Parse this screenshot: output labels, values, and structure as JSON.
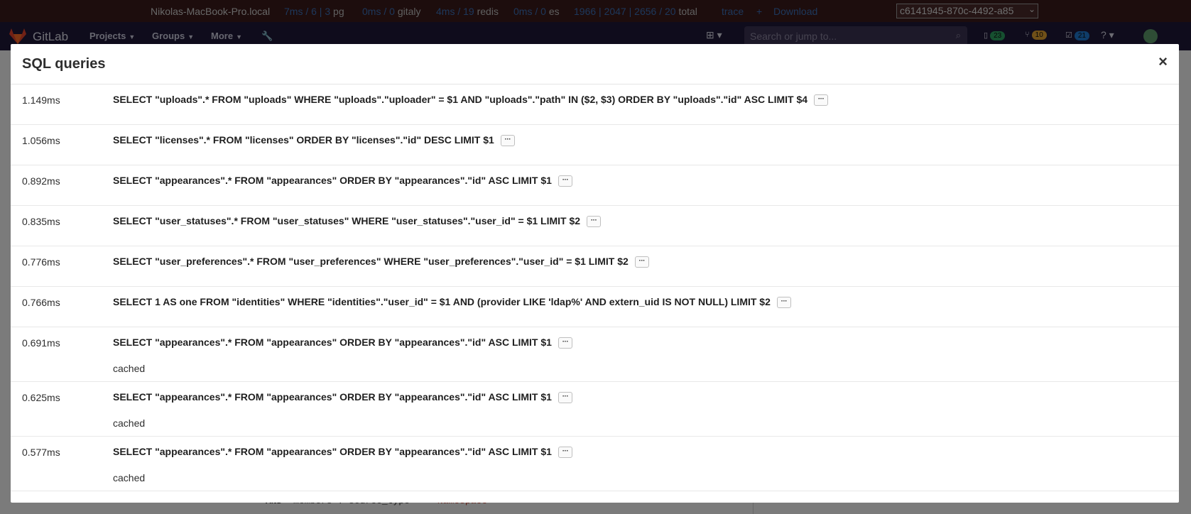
{
  "perf_bar": {
    "host": "Nikolas-MacBook-Pro.local",
    "pg": {
      "time": "7ms",
      "count": "6",
      "calls": "3",
      "label": "pg"
    },
    "gitaly": {
      "time": "0ms",
      "count": "0",
      "label": "gitaly"
    },
    "redis": {
      "time": "4ms",
      "count": "19",
      "label": "redis"
    },
    "es": {
      "time": "0ms",
      "count": "0",
      "label": "es"
    },
    "total": {
      "a": "1966",
      "b": "2047",
      "c": "2656",
      "d": "20",
      "label": "total"
    },
    "trace": "trace",
    "plus": "+",
    "download": "Download",
    "request_id": "c6141945-870c-4492-a85"
  },
  "navbar": {
    "brand": "GitLab",
    "projects": "Projects",
    "groups": "Groups",
    "more": "More",
    "search_placeholder": "Search or jump to...",
    "issues_count": "23",
    "mr_count": "10",
    "todos_count": "21"
  },
  "modal": {
    "title": "SQL queries",
    "close": "×",
    "queries": [
      {
        "duration": "1.149ms",
        "sql": "SELECT \"uploads\".* FROM \"uploads\" WHERE \"uploads\".\"uploader\" = $1 AND \"uploads\".\"path\" IN ($2, $3) ORDER BY \"uploads\".\"id\" ASC LIMIT $4",
        "expand": "···"
      },
      {
        "duration": "1.056ms",
        "sql": "SELECT \"licenses\".* FROM \"licenses\" ORDER BY \"licenses\".\"id\" DESC LIMIT $1",
        "expand": "···"
      },
      {
        "duration": "0.892ms",
        "sql": "SELECT \"appearances\".* FROM \"appearances\" ORDER BY \"appearances\".\"id\" ASC LIMIT $1",
        "expand": "···"
      },
      {
        "duration": "0.835ms",
        "sql": "SELECT \"user_statuses\".* FROM \"user_statuses\" WHERE \"user_statuses\".\"user_id\" = $1 LIMIT $2",
        "expand": "···"
      },
      {
        "duration": "0.776ms",
        "sql": "SELECT \"user_preferences\".* FROM \"user_preferences\" WHERE \"user_preferences\".\"user_id\" = $1 LIMIT $2",
        "expand": "···"
      },
      {
        "duration": "0.766ms",
        "sql": "SELECT 1 AS one FROM \"identities\" WHERE \"identities\".\"user_id\" = $1 AND (provider LIKE 'ldap%' AND extern_uid IS NOT NULL) LIMIT $2",
        "expand": "···"
      },
      {
        "duration": "0.691ms",
        "sql": "SELECT \"appearances\".* FROM \"appearances\" ORDER BY \"appearances\".\"id\" ASC LIMIT $1",
        "expand": "···",
        "cached": "cached"
      },
      {
        "duration": "0.625ms",
        "sql": "SELECT \"appearances\".* FROM \"appearances\" ORDER BY \"appearances\".\"id\" ASC LIMIT $1",
        "expand": "···",
        "cached": "cached"
      },
      {
        "duration": "0.577ms",
        "sql": "SELECT \"appearances\".* FROM \"appearances\" ORDER BY \"appearances\".\"id\" ASC LIMIT $1",
        "expand": "···",
        "cached": "cached"
      }
    ]
  },
  "background": {
    "code_kw": "AND",
    "code_field": "\"members\".\"source_type\" =",
    "code_str": "'Namespace'"
  },
  "colors": {
    "perf_bar_bg": "#3a1b1b",
    "navbar_bg": "#1f1839",
    "link_blue": "#3b6fb6",
    "issues_badge": "#2da160",
    "mr_badge": "#e0a030",
    "todos_badge": "#1f78d1"
  }
}
